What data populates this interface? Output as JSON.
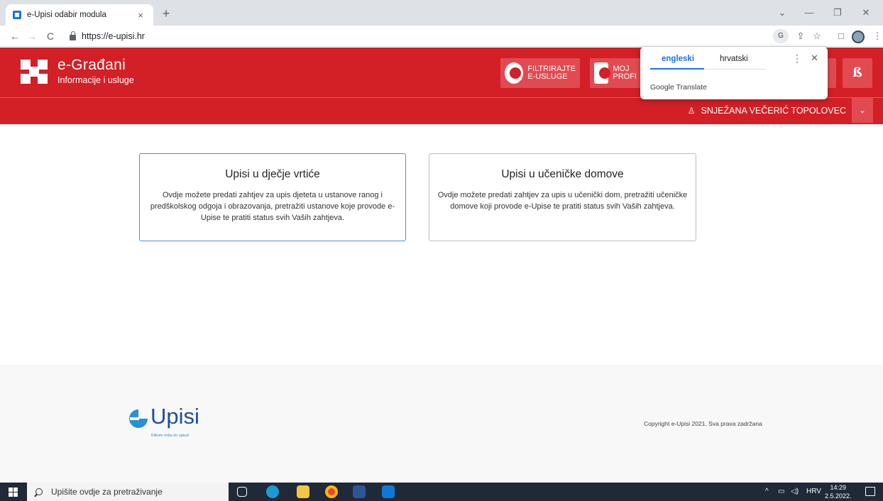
{
  "browser": {
    "tab_title": "e-Upisi odabir modula",
    "tab_close": "×",
    "new_tab": "+",
    "url": "https://e-upisi.hr",
    "window_controls": {
      "minimize": "—",
      "maximize": "❐",
      "close": "✕",
      "menu": "⌄"
    },
    "nav": {
      "back": "←",
      "forward": "→",
      "reload": "C"
    }
  },
  "header": {
    "brand_title": "e-Građani",
    "brand_subtitle": "Informacije i usluge",
    "filter_button_line1": "FILTRIRAJTE",
    "filter_button_line2": "E-USLUGE",
    "profile_button_line1": "MOJ",
    "profile_button_line2": "PROFI",
    "s_button": "ß",
    "user_name": "SNJEŽANA VEČERIĆ TOPOLOVEC",
    "user_icon": "person-icon",
    "caret": "⌄"
  },
  "translate_popup": {
    "lang_english": "engleski",
    "lang_croatian": "hrvatski",
    "menu": "⋮",
    "close": "✕",
    "footer": "Google Translate"
  },
  "modules": [
    {
      "title": "Upisi u dječje vrtiće",
      "description": "Ovdje možete predati zahtjev za upis djeteta u ustanove ranog i predškolskog odgoja i obrazovanja, pretražiti ustanove koje provode e-Upise te pratiti status svih Vaših zahtjeva."
    },
    {
      "title": "Upisi u učeničke domove",
      "description": "Ovdje možete predati zahtjev za upis u učenički dom, pretražiti učeničke domove koji provode e-Upise te pratiti status svih Vaših zahtjeva."
    }
  ],
  "footer": {
    "logo_text": "Upisi",
    "logo_tagline": "Klikom miša do upisa!",
    "copyright": "Copyright e-Upisi 2021. Sva prava zadržana"
  },
  "taskbar": {
    "search_placeholder": "Upišite ovdje za pretraživanje",
    "language": "HRV",
    "time": "14:29",
    "date": "2.5.2022."
  },
  "colors": {
    "header_red": "#d31f26",
    "button_red": "#e14a50",
    "active_border": "#4a90d9",
    "upisi_blue": "#1e4f9c"
  }
}
